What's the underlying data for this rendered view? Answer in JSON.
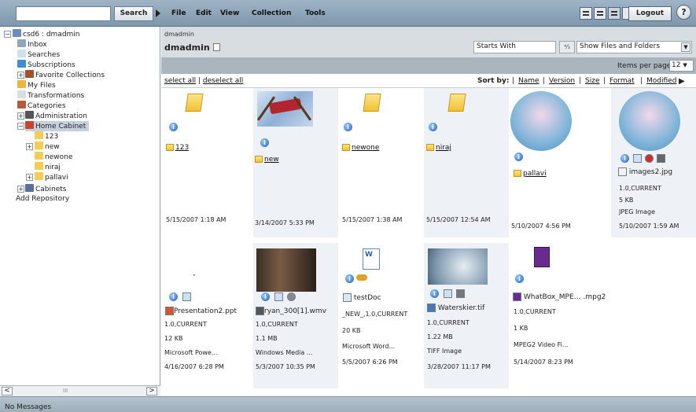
{
  "topbar": {
    "search_placeholder": "",
    "search_label": "Search",
    "menus": [
      "File",
      "Edit",
      "View",
      "Collection",
      "Tools"
    ],
    "logout_label": "Logout",
    "help_label": "?"
  },
  "tree": {
    "root": "csd6 : dmadmin",
    "items": [
      "Inbox",
      "Searches",
      "Subscriptions",
      "Favorite Collections",
      "My Files",
      "Transformations",
      "Categories",
      "Administration",
      "Home Cabinet",
      "123",
      "new",
      "newone",
      "niraj",
      "pallavi",
      "Cabinets",
      "Add Repository"
    ],
    "scroll_mid": "III"
  },
  "header": {
    "breadcrumb": "dmadmin",
    "title": "dmadmin",
    "filter_placeholder": "Starts With",
    "filter_go": "⁴⁄₃",
    "show_option": "Show Files and Folders"
  },
  "paging": {
    "label": "Items per page:",
    "value": "12"
  },
  "sortbar": {
    "select_all": "select all",
    "deselect_all": "deselect all",
    "sort_by": "Sort by:",
    "columns": [
      "Name",
      "Version",
      "Size",
      "Format",
      "Modified"
    ]
  },
  "items": [
    {
      "name": "123",
      "date": "5/15/2007 1:18 AM"
    },
    {
      "name": "new",
      "date": "3/14/2007 5:33 PM"
    },
    {
      "name": "newone",
      "date": "5/15/2007 1:38 AM"
    },
    {
      "name": "niraj",
      "date": "5/15/2007 12:54 AM"
    },
    {
      "name": "pallavi",
      "date": "5/10/2007 4:56 PM"
    },
    {
      "name": "images2.jpg",
      "version": "1.0,CURRENT",
      "size": "5 KB",
      "format": "JPEG Image",
      "date": "5/10/2007 1:59 AM"
    },
    {
      "name": "Presentation2.ppt",
      "version": "1.0,CURRENT",
      "size": "12 KB",
      "format": "Microsoft Powe...",
      "date": "4/16/2007 6:28 PM"
    },
    {
      "name": "ryan_300[1].wmv",
      "version": "1.0,CURRENT",
      "size": "1.1 MB",
      "format": "Windows Media ...",
      "date": "5/3/2007 10:35 PM"
    },
    {
      "name": "testDoc",
      "version": "_NEW_,1.0,CURRENT",
      "size": "20 KB",
      "format": "Microsoft Word...",
      "date": "5/5/2007 6:26 PM"
    },
    {
      "name": "Waterskier.tif",
      "version": "1.0,CURRENT",
      "size": "1.22 MB",
      "format": "TIFF Image",
      "date": "3/28/2007 11:17 PM"
    },
    {
      "name": "WhatBox_MPE… .mpg2",
      "version": "1.0,CURRENT",
      "size": "1 KB",
      "format": "MPEG2 Video Fi...",
      "date": "5/14/2007 8:23 PM"
    }
  ],
  "status": {
    "message": "No Messages"
  },
  "colors": {
    "toolbar": "#8ea3b6",
    "header": "#d8dde1",
    "tile_alt": "#eef1f5",
    "selected": "#c5d2de"
  }
}
